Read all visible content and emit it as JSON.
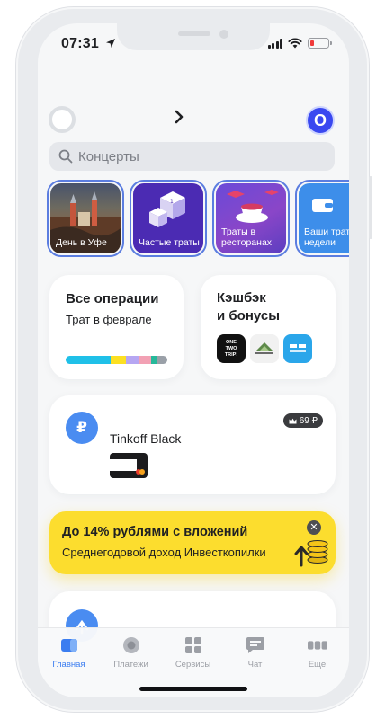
{
  "status_bar": {
    "time": "07:31"
  },
  "search": {
    "placeholder": "Концерты"
  },
  "header": {
    "profile_letter": "О"
  },
  "stories": [
    {
      "caption": "День в Уфе"
    },
    {
      "caption": "Частые траты"
    },
    {
      "caption": "Траты в ресторанах"
    },
    {
      "caption": "Ваши траты недели"
    }
  ],
  "operations": {
    "title": "Все операции",
    "subtitle": "Трат в феврале",
    "segments": [
      {
        "color": "#1fc0e8",
        "share": 0.44
      },
      {
        "color": "#fce022",
        "share": 0.15
      },
      {
        "color": "#b6a6f2",
        "share": 0.13
      },
      {
        "color": "#f2a1b4",
        "share": 0.12
      },
      {
        "color": "#26b89a",
        "share": 0.06
      },
      {
        "color": "#9aa0a8",
        "share": 0.1
      }
    ]
  },
  "cashback": {
    "title_line1": "Кэшбэк",
    "title_line2": "и бонусы",
    "partners": [
      {
        "name": "ONE TWO TRIP!",
        "bg": "#111111"
      },
      {
        "name": "leroy-merlin-icon",
        "bg": "#f1f1f1"
      },
      {
        "name": "travel-icon",
        "bg": "#2aa6ea"
      }
    ]
  },
  "account": {
    "name": "Tinkoff Black",
    "badge": "69 ₽",
    "currency_symbol": "₽"
  },
  "promo": {
    "title": "До 14% рублями с вложений",
    "subtitle": "Среднегодовой доход Инвесткопилки"
  },
  "tabs": [
    {
      "label": "Главная",
      "icon": "home-icon",
      "active": true
    },
    {
      "label": "Платежи",
      "icon": "payments-icon",
      "active": false
    },
    {
      "label": "Сервисы",
      "icon": "services-icon",
      "active": false
    },
    {
      "label": "Чат",
      "icon": "chat-icon",
      "active": false
    },
    {
      "label": "Еще",
      "icon": "more-icon",
      "active": false
    }
  ],
  "colors": {
    "accent": "#3b7df0",
    "promo": "#fcdd2e",
    "profile": "#3a48f0"
  }
}
